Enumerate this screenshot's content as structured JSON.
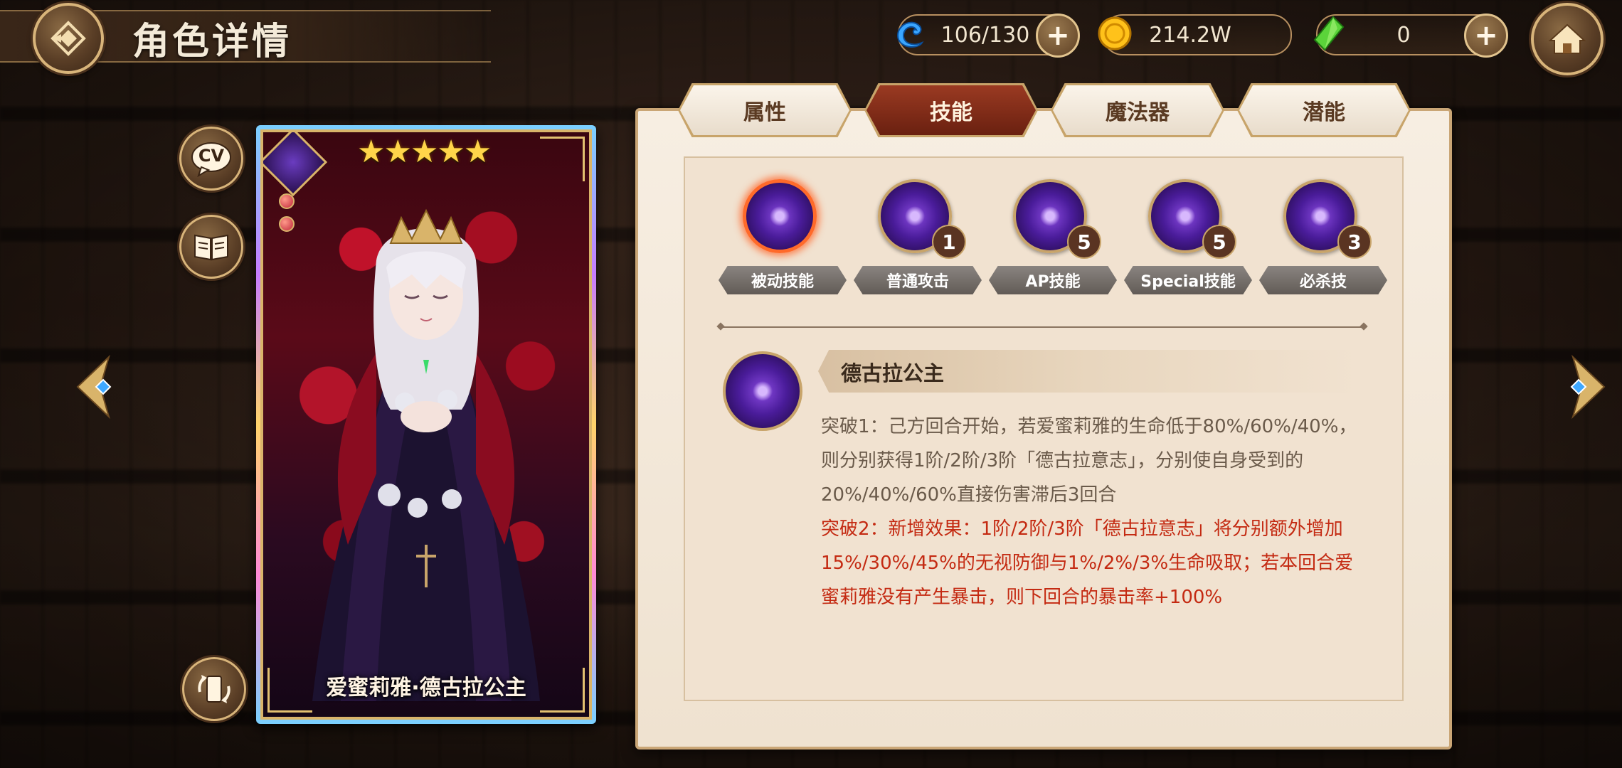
{
  "header": {
    "title": "角色详情"
  },
  "resources": {
    "stamina": "106/130",
    "gold": "214.2W",
    "gems": "0"
  },
  "tabs": [
    {
      "label": "属性"
    },
    {
      "label": "技能"
    },
    {
      "label": "魔法器"
    },
    {
      "label": "潜能"
    }
  ],
  "active_tab": "技能",
  "character": {
    "name": "爱蜜莉雅·德古拉公主",
    "stars": "★★★★★"
  },
  "side_buttons": {
    "cv_label": "CV"
  },
  "skills": [
    {
      "label": "被动技能",
      "level": ""
    },
    {
      "label": "普通攻击",
      "level": "1"
    },
    {
      "label": "AP技能",
      "level": "5"
    },
    {
      "label": "Special技能",
      "level": "5"
    },
    {
      "label": "必杀技",
      "level": "3"
    }
  ],
  "selected_skill": {
    "name": "德古拉公主",
    "breakthrough_1": "突破1：己方回合开始，若爱蜜莉雅的生命低于80%/60%/40%，则分别获得1阶/2阶/3阶「德古拉意志」，分别使自身受到的20%/40%/60%直接伤害滞后3回合",
    "breakthrough_2": "突破2：新增效果：1阶/2阶/3阶「德古拉意志」将分别额外增加15%/30%/45%的无视防御与1%/2%/3%生命吸取；若本回合爱蜜莉雅没有产生暴击，则下回合的暴击率+100%"
  },
  "colors": {
    "accent_active_tab": "#7a2814",
    "highlight_text": "#c42a12",
    "panel_bg": "#f1e2d0"
  }
}
